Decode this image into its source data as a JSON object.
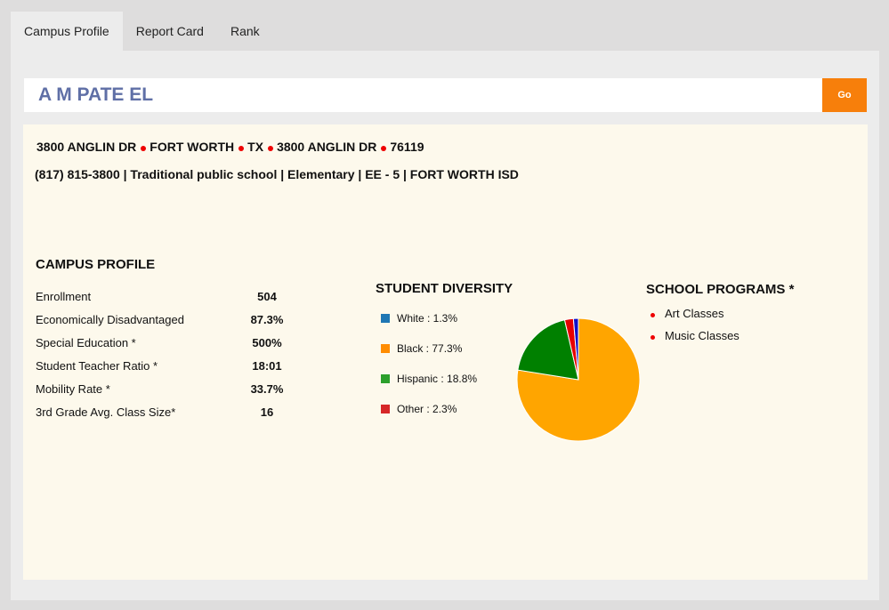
{
  "tabs": [
    {
      "label": "Campus Profile"
    },
    {
      "label": "Report Card"
    },
    {
      "label": "Rank"
    }
  ],
  "search": {
    "value": "A M PATE EL",
    "go_label": "Go"
  },
  "address": {
    "street": "3800 ANGLIN DR",
    "city": "FORT WORTH",
    "state": "TX",
    "street2": "3800 ANGLIN DR",
    "zip": "76119"
  },
  "meta_line": "(817) 815-3800 | Traditional public school | Elementary | EE - 5 | FORT WORTH ISD",
  "campus_profile": {
    "heading": "CAMPUS PROFILE",
    "rows": [
      {
        "label": "Enrollment",
        "value": "504"
      },
      {
        "label": "Economically Disadvantaged",
        "value": "87.3%"
      },
      {
        "label": "Special Education *",
        "value": "500%"
      },
      {
        "label": "Student Teacher Ratio *",
        "value": "18:01"
      },
      {
        "label": "Mobility Rate *",
        "value": "33.7%"
      },
      {
        "label": "3rd Grade Avg. Class Size*",
        "value": "16"
      }
    ]
  },
  "diversity": {
    "heading": "STUDENT DIVERSITY",
    "legend": [
      {
        "label": "White : 1.3%",
        "color": "#1f77b4"
      },
      {
        "label": "Black : 77.3%",
        "color": "#ff8c00"
      },
      {
        "label": "Hispanic : 18.8%",
        "color": "#2ca02c"
      },
      {
        "label": "Other : 2.3%",
        "color": "#d62728"
      }
    ]
  },
  "chart_data": {
    "type": "pie",
    "title": "STUDENT DIVERSITY",
    "slices": [
      {
        "label": "Black",
        "value": 77.3,
        "color": "#ffa500"
      },
      {
        "label": "Hispanic",
        "value": 18.8,
        "color": "#008000"
      },
      {
        "label": "Other",
        "value": 2.3,
        "color": "#e60000"
      },
      {
        "label": "White",
        "value": 1.3,
        "color": "#1010c8"
      }
    ],
    "start_angle_deg": 0,
    "direction": "clockwise",
    "legend_position": "left"
  },
  "programs": {
    "heading": "SCHOOL PROGRAMS *",
    "items": [
      {
        "label": "Art Classes"
      },
      {
        "label": "Music Classes"
      }
    ]
  }
}
